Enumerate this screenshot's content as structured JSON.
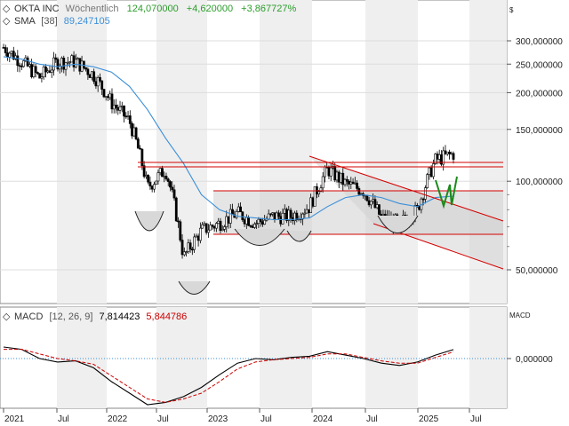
{
  "header": {
    "symbol": "OKTA INC",
    "interval": "Wöchentlich",
    "price": "124,070000",
    "change": "+4,620000",
    "change_pct": "+3,867727%",
    "sma_label": "SMA",
    "sma_period": "[38]",
    "sma_value": "89,247105"
  },
  "macd_header": {
    "label": "MACD",
    "params": "[12, 26, 9]",
    "value": "7,814423",
    "signal": "5,844786"
  },
  "right_axis": {
    "currency": "$",
    "price_ticks": [
      "300,000000",
      "250,000000",
      "200,000000",
      "150,000000",
      "100,000000",
      "50,000000"
    ],
    "macd_label": "MACD",
    "macd_tick": "0,000000"
  },
  "x_axis": [
    "2021",
    "Jul",
    "2022",
    "Jul",
    "2023",
    "Jul",
    "2024",
    "Jul",
    "2025",
    "Jul"
  ],
  "colors": {
    "up": "#ffffff",
    "down": "#000000",
    "sma": "#3b8fd8",
    "macd_signal": "#cc0000",
    "resistance": "#d40000",
    "pattern": "#1a8a1a",
    "price_header": "#2a9d2a",
    "sma_value": "#3b8fd8",
    "macd_signal_value": "#cc0000"
  },
  "chart_data": {
    "type": "candlestick",
    "scale": "log",
    "interval": "weekly",
    "x": [
      "2021-01",
      "2021-03",
      "2021-05",
      "2021-07",
      "2021-09",
      "2021-11",
      "2022-01",
      "2022-03",
      "2022-05",
      "2022-07",
      "2022-09",
      "2022-11",
      "2023-01",
      "2023-03",
      "2023-05",
      "2023-07",
      "2023-09",
      "2023-11",
      "2024-01",
      "2024-03",
      "2024-05",
      "2024-07",
      "2024-09",
      "2024-11",
      "2025-01",
      "2025-03"
    ],
    "close": [
      285,
      255,
      225,
      255,
      255,
      230,
      185,
      160,
      95,
      110,
      55,
      68,
      72,
      78,
      72,
      76,
      76,
      82,
      110,
      98,
      93,
      75,
      72,
      80,
      118,
      124
    ],
    "sma": [
      265,
      260,
      250,
      245,
      250,
      245,
      235,
      210,
      175,
      140,
      115,
      90,
      80,
      76,
      75,
      74,
      74,
      75,
      82,
      88,
      90,
      88,
      84,
      82,
      88,
      89
    ],
    "macd": [
      10,
      8,
      0,
      -3,
      -2,
      -8,
      -20,
      -30,
      -40,
      -38,
      -33,
      -25,
      -14,
      -4,
      0,
      -1,
      1,
      2,
      6,
      3,
      0,
      -4,
      -6,
      -3,
      3,
      7.8
    ],
    "signal": [
      8,
      8,
      4,
      0,
      -2,
      -5,
      -15,
      -25,
      -35,
      -38,
      -35,
      -30,
      -20,
      -9,
      -3,
      -1,
      0,
      1,
      4,
      4,
      1,
      -2,
      -4,
      -4,
      1,
      5.8
    ],
    "macd_value": 7.814423,
    "signal_value": 5.844786,
    "horizontal_levels": [
      117,
      112,
      92,
      85,
      66
    ],
    "channel_upper": [
      [
        "2023-12",
        123
      ],
      [
        "2025-07",
        74
      ]
    ],
    "channel_lower": [
      [
        "2024-09",
        70
      ],
      [
        "2025-07",
        50
      ]
    ],
    "ylim": [
      40,
      340
    ],
    "xlabel": "",
    "ylabel": ""
  }
}
